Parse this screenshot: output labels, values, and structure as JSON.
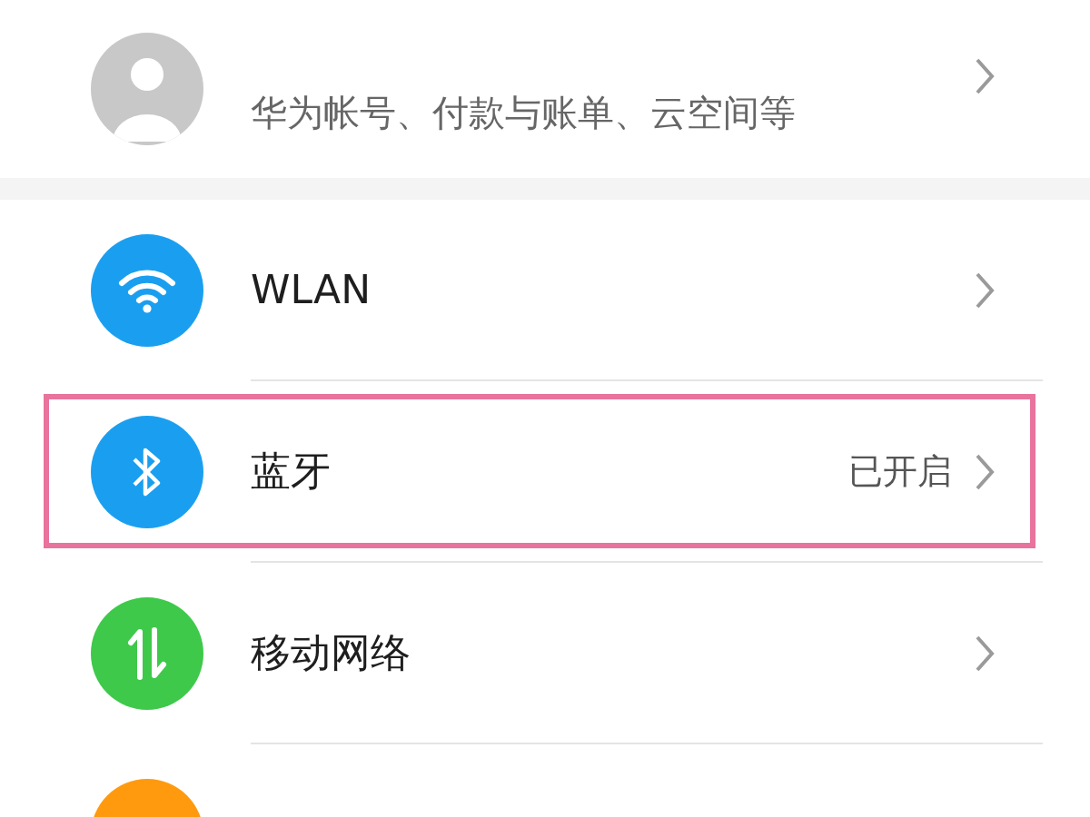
{
  "account": {
    "subtitle": "华为帐号、付款与账单、云空间等"
  },
  "settings": [
    {
      "kind": "wifi",
      "label": "WLAN",
      "color": "#1a9ff0",
      "highlighted": false
    },
    {
      "kind": "bluetooth",
      "label": "蓝牙",
      "status": "已开启",
      "color": "#1a9ff0",
      "highlighted": true
    },
    {
      "kind": "mobile",
      "label": "移动网络",
      "color": "#3ec94a",
      "highlighted": false
    },
    {
      "kind": "partial",
      "color": "#ff9a0e",
      "highlighted": false
    }
  ]
}
